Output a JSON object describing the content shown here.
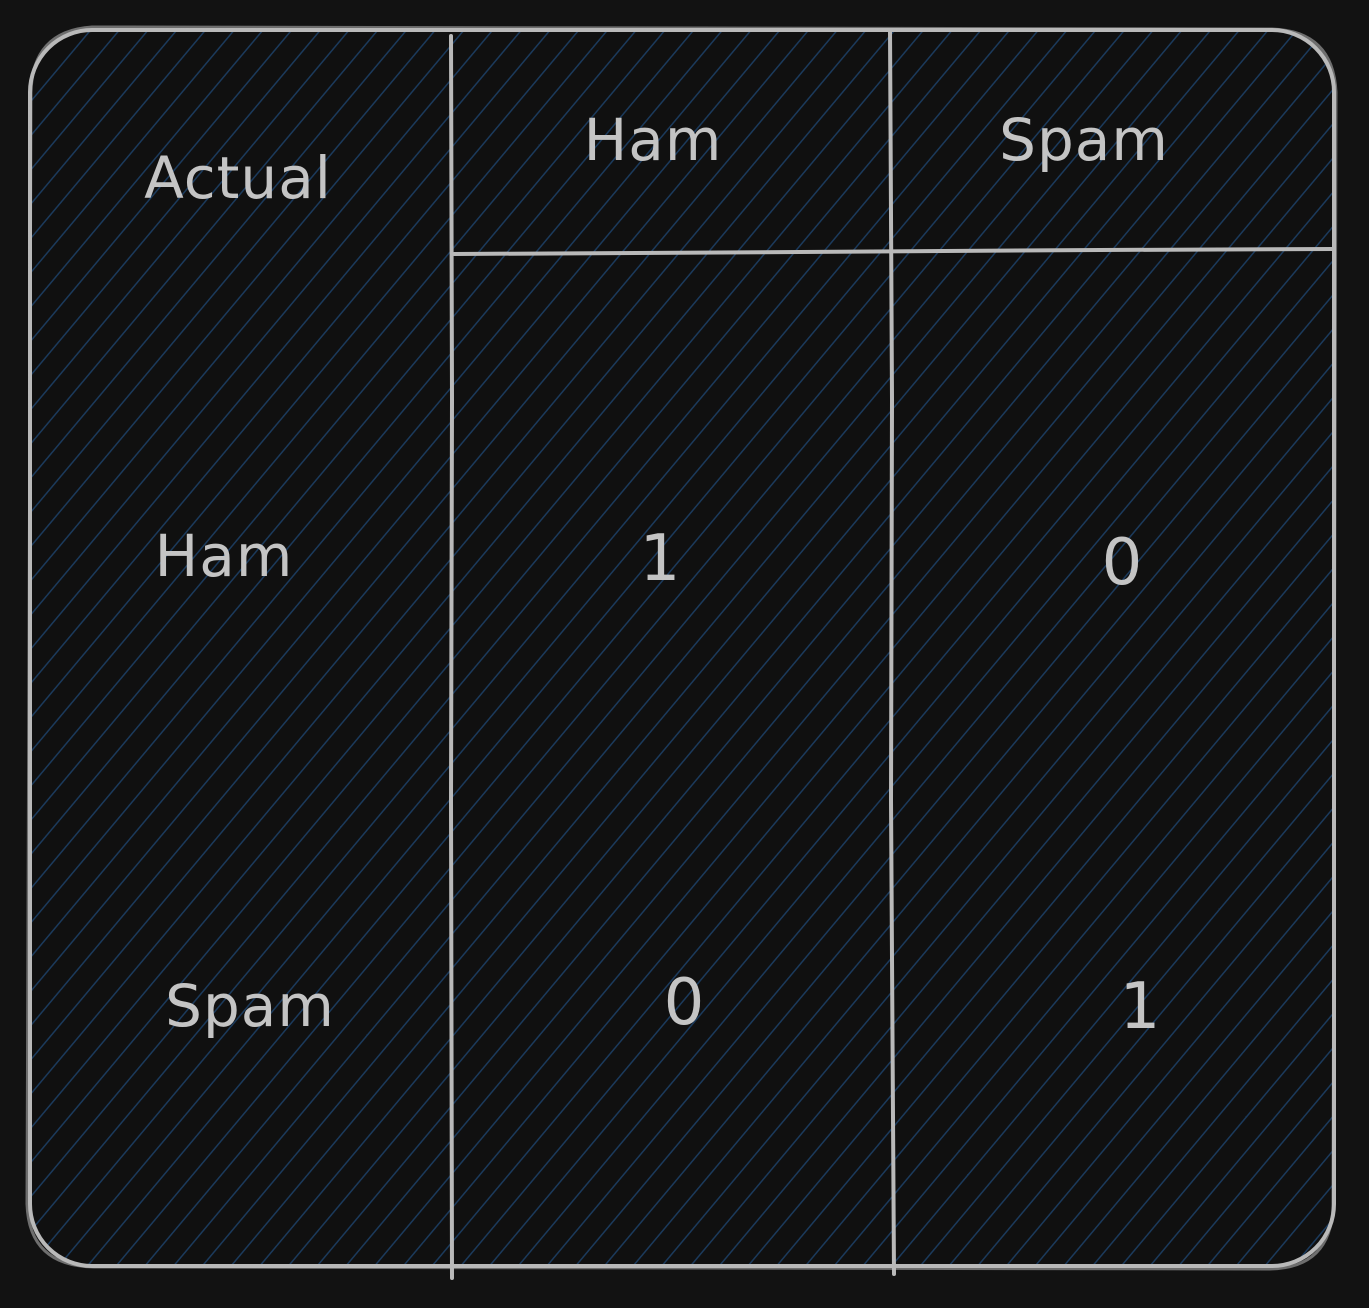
{
  "colors": {
    "background": "#121212",
    "fill": "#101010",
    "hatch": "#1b3a5c",
    "stroke": "#b9b9b9",
    "text": "#c4c4c4"
  },
  "table": {
    "corner_label": "Actual",
    "column_headers": [
      "Ham",
      "Spam"
    ],
    "rows": [
      {
        "label": "Ham",
        "values": [
          "1",
          "0"
        ]
      },
      {
        "label": "Spam",
        "values": [
          "0",
          "1"
        ]
      }
    ]
  }
}
